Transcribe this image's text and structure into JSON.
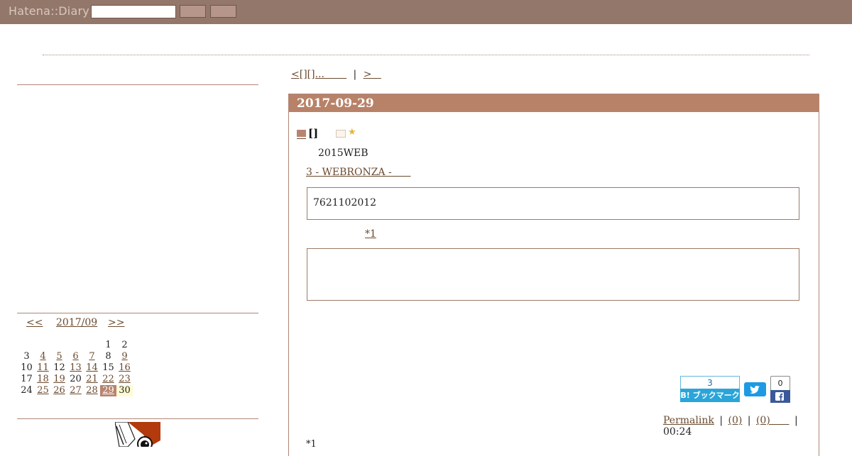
{
  "header": {
    "brand": "Hatena::Diary",
    "search_value": "",
    "button1_label": "",
    "button2_label": ""
  },
  "nav": {
    "prev_link": "<[][]...       ",
    "separator": "|",
    "next_link": ">   "
  },
  "sidebar": {
    "calendar": {
      "prev": "<<",
      "month": "2017/09",
      "next": ">>",
      "rows": [
        [
          "",
          "",
          "",
          "",
          "",
          "1",
          "2"
        ],
        [
          "3",
          "4",
          "5",
          "6",
          "7",
          "8",
          "9"
        ],
        [
          "10",
          "11",
          "12",
          "13",
          "14",
          "15",
          "16"
        ],
        [
          "17",
          "18",
          "19",
          "20",
          "21",
          "22",
          "23"
        ],
        [
          "24",
          "25",
          "26",
          "27",
          "28",
          "29",
          "30"
        ]
      ],
      "linked_days": [
        "4",
        "5",
        "6",
        "7",
        "9",
        "11",
        "13",
        "14",
        "16",
        "18",
        "19",
        "21",
        "22",
        "23",
        "25",
        "26",
        "27",
        "28",
        "29"
      ],
      "selected_day": "29",
      "today": "30"
    }
  },
  "entry": {
    "date": "2017-09-29",
    "section_title": "[]",
    "body_text": "2015WEB",
    "body_link": "3 - WEBRONZA -      ",
    "quote1_text": "7621102012",
    "footnote_ref": "*1",
    "quote2_text": "",
    "hatena_bookmark_count": "3",
    "hatena_bookmark_label": "B! ブックマーク",
    "facebook_count": "0",
    "footer": {
      "permalink": "Permalink",
      "sep": "|",
      "comments": "(0)",
      "trackbacks": "(0)      ",
      "time": "00:24"
    },
    "footnote": "*1"
  },
  "colors": {
    "topbar": "#93776a",
    "date_bar": "#b88268",
    "link": "#6b4a2e",
    "hatena_blue": "#2ba5d9",
    "twitter_blue": "#1d9ae4",
    "facebook_blue": "#3b5998"
  }
}
